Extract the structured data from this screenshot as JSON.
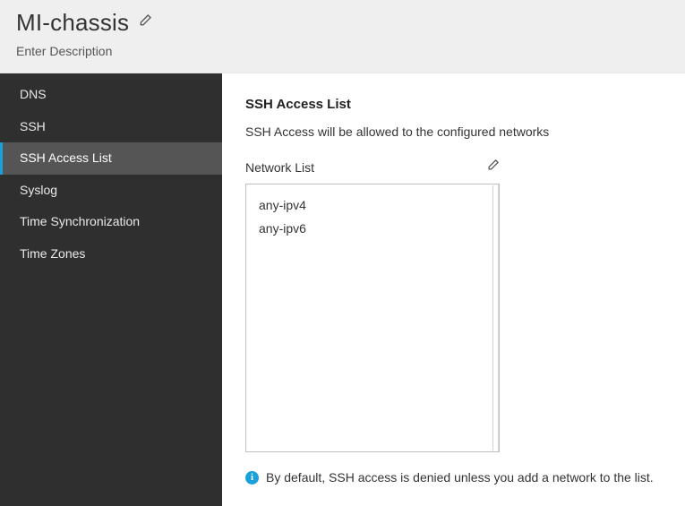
{
  "header": {
    "title": "MI-chassis",
    "description": "Enter Description"
  },
  "sidebar": {
    "items": [
      {
        "label": "DNS",
        "active": false
      },
      {
        "label": "SSH",
        "active": false
      },
      {
        "label": "SSH Access List",
        "active": true
      },
      {
        "label": "Syslog",
        "active": false
      },
      {
        "label": "Time Synchronization",
        "active": false
      },
      {
        "label": "Time Zones",
        "active": false
      }
    ]
  },
  "main": {
    "section_title": "SSH Access List",
    "section_sub": "SSH Access will be allowed to the configured networks",
    "list_label": "Network List",
    "network_items": [
      "any-ipv4",
      "any-ipv6"
    ],
    "note": "By default, SSH access is denied unless you add a network to the list."
  },
  "icons": {
    "pencil": "pencil-icon",
    "info": "info-icon"
  }
}
